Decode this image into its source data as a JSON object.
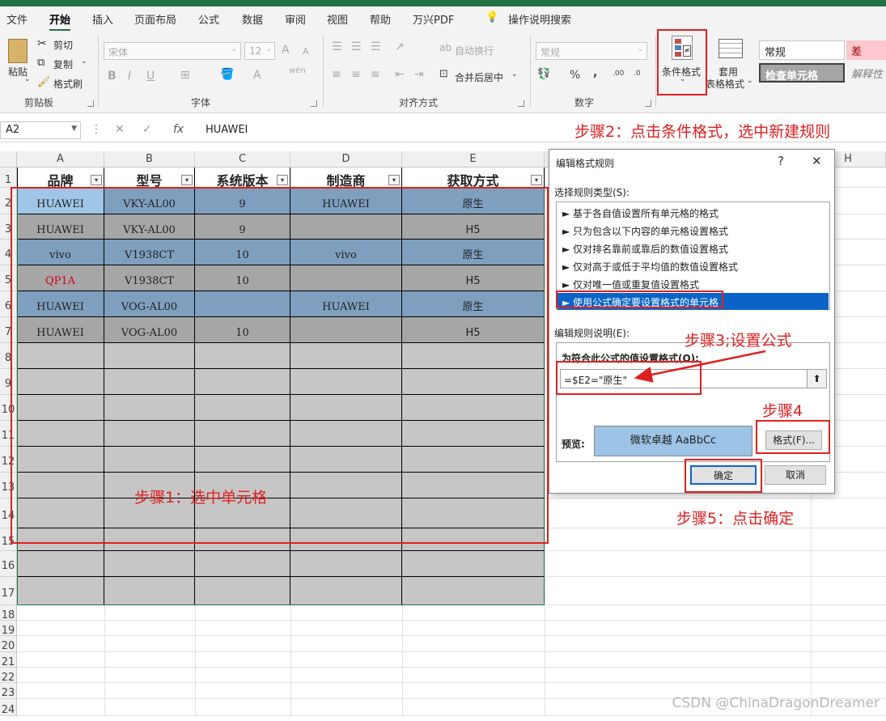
{
  "ribbon_tabs": [
    "文件",
    "开始",
    "插入",
    "页面布局",
    "公式",
    "数据",
    "审阅",
    "视图",
    "帮助",
    "万兴PDF"
  ],
  "tell_me": "操作说明搜索",
  "clipboard": {
    "paste": "粘贴",
    "cut": "剪切",
    "copy": "复制",
    "format_painter": "格式刷",
    "group": "剪贴板"
  },
  "font": {
    "name": "宋体",
    "size": "12",
    "group": "字体",
    "bold": "B",
    "italic": "I",
    "underline": "U",
    "grow": "A",
    "shrink": "A",
    "phonetic": "wén",
    "color": "A"
  },
  "alignment": {
    "wrap": "自动换行",
    "merge": "合并后居中",
    "group": "对齐方式"
  },
  "number": {
    "format": "常规",
    "group": "数字",
    "percent": "%",
    "comma": ","
  },
  "styles": {
    "conditional": "条件格式",
    "table_line1": "套用",
    "table_line2": "表格格式",
    "normal": "常规",
    "bad": "差",
    "check": "检查单元格",
    "explanatory": "解释性"
  },
  "formula_bar": {
    "name_box": "A2",
    "value": "HUAWEI"
  },
  "columns": [
    "A",
    "B",
    "C",
    "D",
    "E",
    "H"
  ],
  "rows": [
    "1",
    "2",
    "3",
    "4",
    "5",
    "6",
    "7",
    "8",
    "9",
    "10",
    "11",
    "12",
    "13",
    "14",
    "15",
    "16",
    "17",
    "18",
    "19",
    "20",
    "21",
    "22",
    "23",
    "24"
  ],
  "table": {
    "headers": [
      "品牌",
      "型号",
      "系统版本",
      "制造商",
      "获取方式"
    ],
    "data": [
      [
        "HUAWEI",
        "VKY-AL00",
        "9",
        "HUAWEI",
        "原生"
      ],
      [
        "HUAWEI",
        "VKY-AL00",
        "9",
        "",
        "H5"
      ],
      [
        "vivo",
        "V1938CT",
        "10",
        "vivo",
        "原生"
      ],
      [
        "QP1A",
        "V1938CT",
        "10",
        "",
        "H5"
      ],
      [
        "HUAWEI",
        "VOG-AL00",
        "",
        "HUAWEI",
        "原生"
      ],
      [
        "HUAWEI",
        "VOG-AL00",
        "10",
        "",
        "H5"
      ]
    ],
    "filter_glyph": "▾"
  },
  "colors": {
    "blue_row": "#7f9fbf",
    "gray_row": "#a6a6a6",
    "empty_area": "#c6c6c6",
    "a2_fill": "#9fc6e7",
    "red_text": "#d9001b",
    "annotation": "#e02020",
    "accent": "#217346"
  },
  "dialog": {
    "title": "编辑格式规则",
    "help": "?",
    "close": "✕",
    "select_type_label": "选择规则类型(S):",
    "rule_types": [
      "► 基于各自值设置所有单元格的格式",
      "► 只为包含以下内容的单元格设置格式",
      "► 仅对排名靠前或靠后的数值设置格式",
      "► 仅对高于或低于平均值的数值设置格式",
      "► 仅对唯一值或重复值设置格式",
      "► 使用公式确定要设置格式的单元格"
    ],
    "edit_label": "编辑规则说明(E):",
    "formula_label": "为符合此公式的值设置格式(O):",
    "formula": "=$E2=\"原生\"",
    "collapse": "⬆",
    "preview_label": "预览:",
    "preview_text": "微软卓越  AaBbCc",
    "format_button": "格式(F)...",
    "ok": "确定",
    "cancel": "取消"
  },
  "annotations": {
    "step1": "步骤1：选中单元格",
    "step2": "步骤2：点击条件格式，选中新建规则",
    "step3": "步骤3;设置公式",
    "step4": "步骤4",
    "step5": "步骤5：点击确定"
  },
  "watermark": "CSDN @ChinaDragonDreamer"
}
